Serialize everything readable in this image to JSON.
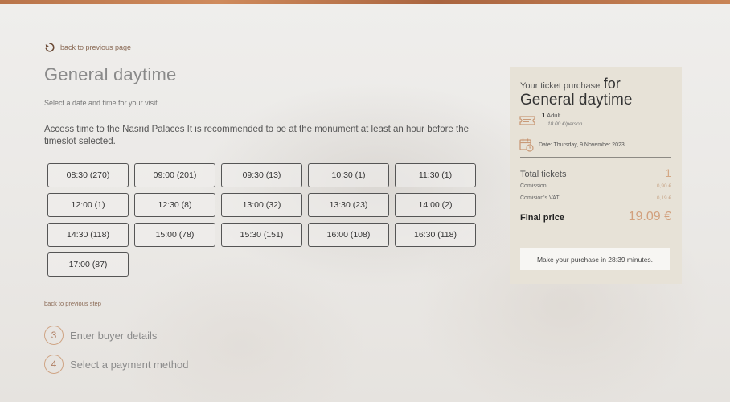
{
  "nav": {
    "back_to_previous_page": "back to previous page",
    "back_to_previous_step": "back to previous step"
  },
  "header": {
    "title": "General daytime",
    "subtitle": "Select a date and time for your visit",
    "notice": "Access time to the Nasrid Palaces It is recommended to be at the monument at least an hour before the timeslot selected."
  },
  "timeslots": [
    "08:30 (270)",
    "09:00 (201)",
    "09:30 (13)",
    "10:30 (1)",
    "11:30 (1)",
    "12:00 (1)",
    "12:30 (8)",
    "13:00 (32)",
    "13:30 (23)",
    "14:00 (2)",
    "14:30 (118)",
    "15:00 (78)",
    "15:30 (151)",
    "16:00 (108)",
    "16:30 (118)",
    "17:00 (87)"
  ],
  "steps": [
    {
      "number": "3",
      "label": "Enter buyer details"
    },
    {
      "number": "4",
      "label": "Select a payment method"
    }
  ],
  "summary": {
    "heading_small": "Your ticket purchase",
    "heading_for": "for",
    "heading_name": "General daytime",
    "ticket_count": "1",
    "ticket_type": "Adult",
    "ticket_price": "18.00 €/person",
    "date": "Date: Thursday, 9 November 2023",
    "total_tickets_label": "Total tickets",
    "total_tickets_value": "1",
    "commission_label": "Comission",
    "commission_value": "0,90 €",
    "vat_label": "Comision's VAT",
    "vat_value": "0,19 €",
    "final_label": "Final price",
    "final_value": "19.09 €",
    "timer_text": "Make your purchase in 28:39 minutes."
  },
  "colors": {
    "accent": "#d2a07d",
    "slot_border": "#555555",
    "panel_bg": "#e7e2d7"
  },
  "icons": {
    "back": "undo-arrow-icon",
    "ticket": "ticket-icon",
    "calendar": "calendar-clock-icon"
  }
}
